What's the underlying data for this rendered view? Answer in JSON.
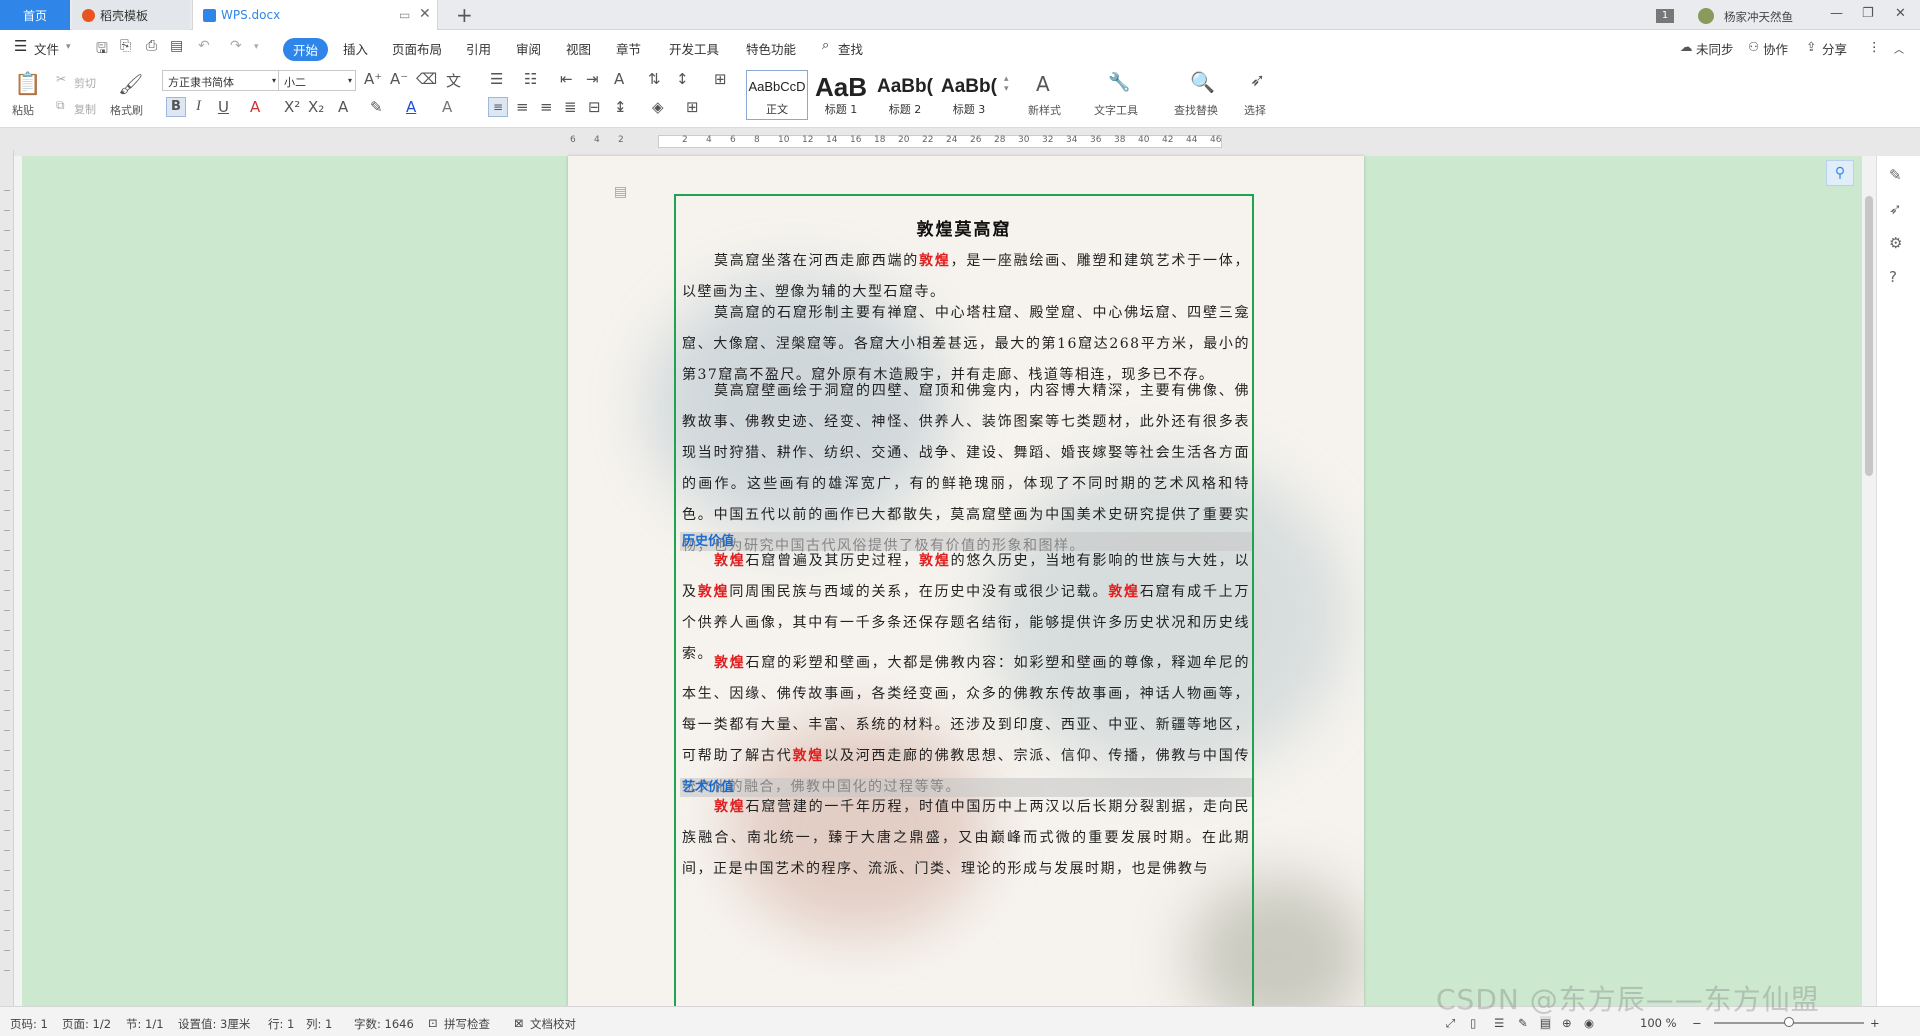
{
  "titlebar": {
    "tabs": [
      {
        "label": "首页"
      },
      {
        "label": "稻壳模板"
      },
      {
        "label": "WPS.docx"
      }
    ],
    "badge": "1",
    "user": "杨家冲天然鱼"
  },
  "menu": {
    "file": "文件",
    "items": [
      "开始",
      "插入",
      "页面布局",
      "引用",
      "审阅",
      "视图",
      "章节",
      "开发工具",
      "特色功能"
    ],
    "search": "查找",
    "sync": "未同步",
    "collab": "协作",
    "share": "分享"
  },
  "toolbar": {
    "paste": "粘贴",
    "cut": "剪切",
    "copy": "复制",
    "format_painter": "格式刷",
    "font_name": "方正隶书简体",
    "font_size": "小二",
    "styles": [
      {
        "preview": "AaBbCcD",
        "label": "正文"
      },
      {
        "preview": "AaB",
        "label": "标题 1"
      },
      {
        "preview": "AaBb(",
        "label": "标题 2"
      },
      {
        "preview": "AaBb(",
        "label": "标题 3"
      }
    ],
    "new_style": "新样式",
    "text_tool": "文字工具",
    "find_replace": "查找替换",
    "select": "选择"
  },
  "ruler": {
    "numbers": [
      "6",
      "4",
      "2",
      "2",
      "4",
      "6",
      "8",
      "10",
      "12",
      "14",
      "16",
      "18",
      "20",
      "22",
      "24",
      "26",
      "28",
      "30",
      "32",
      "34",
      "36",
      "38",
      "40",
      "42",
      "44",
      "46"
    ]
  },
  "document": {
    "title": "敦煌莫高窟",
    "heading_history": "历史价值",
    "heading_art": "艺术价值",
    "p1": [
      {
        "t": "莫高窟坐落在河西走廊西端的"
      },
      {
        "t": "敦煌",
        "kw": true
      },
      {
        "t": "，是一座融绘画、雕塑和建筑艺术于一体，以壁画为主、塑像为辅的大型石窟寺。"
      }
    ],
    "p2": "莫高窟的石窟形制主要有禅窟、中心塔柱窟、殿堂窟、中心佛坛窟、四壁三龛窟、大像窟、涅槃窟等。各窟大小相差甚远，最大的第16窟达268平方米，最小的第37窟高不盈尺。窟外原有木造殿宇，并有走廊、栈道等相连，现多已不存。",
    "p3": "莫高窟壁画绘于洞窟的四壁、窟顶和佛龛内，内容博大精深，主要有佛像、佛教故事、佛教史迹、经变、神怪、供养人、装饰图案等七类题材，此外还有很多表现当时狩猎、耕作、纺织、交通、战争、建设、舞蹈、婚丧嫁娶等社会生活各方面的画作。这些画有的雄浑宽广，有的鲜艳瑰丽，体现了不同时期的艺术风格和特色。中国五代以前的画作已大都散失，莫高窟壁画为中国美术史研究提供了重要实物，也为研究中国古代风俗提供了极有价值的形象和图样。",
    "p4": [
      {
        "t": "敦煌",
        "kw": true
      },
      {
        "t": "石窟曾遍及其历史过程，"
      },
      {
        "t": "敦煌",
        "kw": true
      },
      {
        "t": "的悠久历史，当地有影响的世族与大姓，以及"
      },
      {
        "t": "敦煌",
        "kw": true
      },
      {
        "t": "同周围民族与西域的关系，在历史中没有或很少记载。"
      },
      {
        "t": "敦煌",
        "kw": true
      },
      {
        "t": "石窟有成千上万个供养人画像，其中有一千多条还保存题名结衔，能够提供许多历史状况和历史线索。"
      }
    ],
    "p5": [
      {
        "t": "敦煌",
        "kw": true
      },
      {
        "t": "石窟的彩塑和壁画，大都是佛教内容：如彩塑和壁画的尊像，释迦牟尼的本生、因缘、佛传故事画，各类经变画，众多的佛教东传故事画，神话人物画等，每一类都有大量、丰富、系统的材料。还涉及到印度、西亚、中亚、新疆等地区，可帮助了解古代"
      },
      {
        "t": "敦煌",
        "kw": true
      },
      {
        "t": "以及河西走廊的佛教思想、宗派、信仰、传播，佛教与中国传统文化的融合，佛教中国化的过程等等。"
      }
    ],
    "p6": [
      {
        "t": "敦煌",
        "kw": true
      },
      {
        "t": "石窟营建的一千年历程，时值中国历中上两汉以后长期分裂割据，走向民族融合、南北统一，臻于大唐之鼎盛，又由巅峰而式微的重要发展时期。在此期间，正是中国艺术的程序、流派、门类、理论的形成与发展时期，也是佛教与"
      }
    ]
  },
  "statusbar": {
    "page_num": "页码: 1",
    "page": "页面: 1/2",
    "section": "节: 1/1",
    "setting": "设置值: 3厘米",
    "row": "行: 1",
    "col": "列: 1",
    "wordcount": "字数: 1646",
    "spellcheck": "拼写检查",
    "proof": "文档校对",
    "zoom": "100 %"
  },
  "watermark": "CSDN @东方辰——东方仙盟",
  "colors": {
    "accent": "#2f86e8",
    "frame": "#1fa351",
    "keyword": "#e02020",
    "heading": "#1a6cd0",
    "workspace": "#cce8cf"
  }
}
